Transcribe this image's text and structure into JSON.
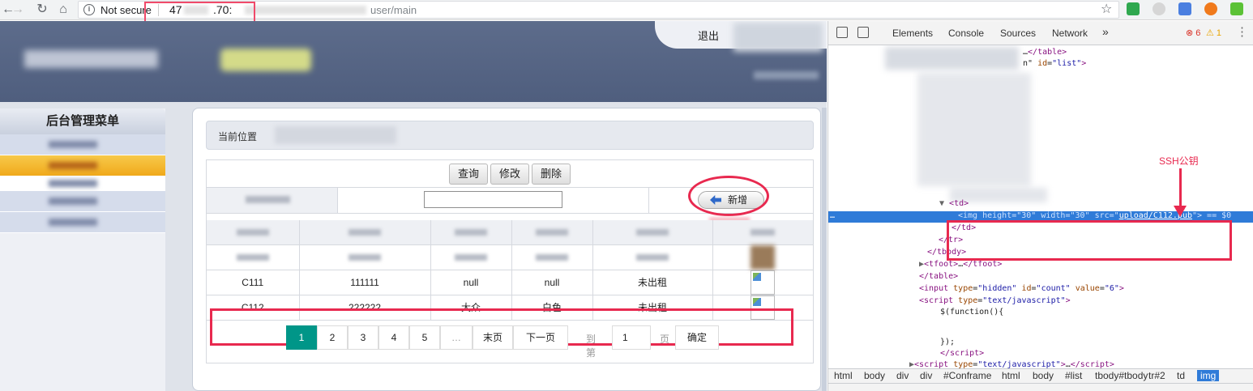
{
  "browser": {
    "security_label": "Not secure",
    "url_ip_prefix": "47",
    "url_ip_suffix": ".70:",
    "url_path": "user/main"
  },
  "header": {
    "logout_label": "退出"
  },
  "sidebar": {
    "title": "后台管理菜单"
  },
  "main": {
    "breadcrumb_label": "当前位置",
    "toolbar": {
      "query_label": "查询",
      "edit_label": "修改",
      "delete_label": "删除",
      "add_label": "新增"
    },
    "table": {
      "rows": [
        [
          "C111",
          "111111",
          "null",
          "null",
          "未出租"
        ],
        [
          "C112",
          "222222",
          "大众",
          "白色",
          "未出租"
        ]
      ]
    },
    "pager": {
      "pages": [
        "1",
        "2",
        "3",
        "4",
        "5",
        "…"
      ],
      "last_label": "末页",
      "next_label": "下一页",
      "goto_label": "到第",
      "goto_value": "1",
      "page_unit": "页",
      "confirm_label": "确定"
    }
  },
  "devtools": {
    "tabs": [
      "Elements",
      "Console",
      "Sources",
      "Network"
    ],
    "error_count": "6",
    "warning_count": "1",
    "annotation": "SSH公钥",
    "breadcrumbs": [
      "html",
      "body",
      "div",
      "div",
      "#Conframe",
      "html",
      "body",
      "#list",
      "tbody#tbody",
      "tr#2",
      "td",
      "img"
    ]
  },
  "colors": {
    "banner": "#5d6c8b",
    "menu_active": "#f0a91b",
    "pager_active": "#009688",
    "highlight": "#e8294f",
    "devtools_selection": "#2f7bd8"
  }
}
